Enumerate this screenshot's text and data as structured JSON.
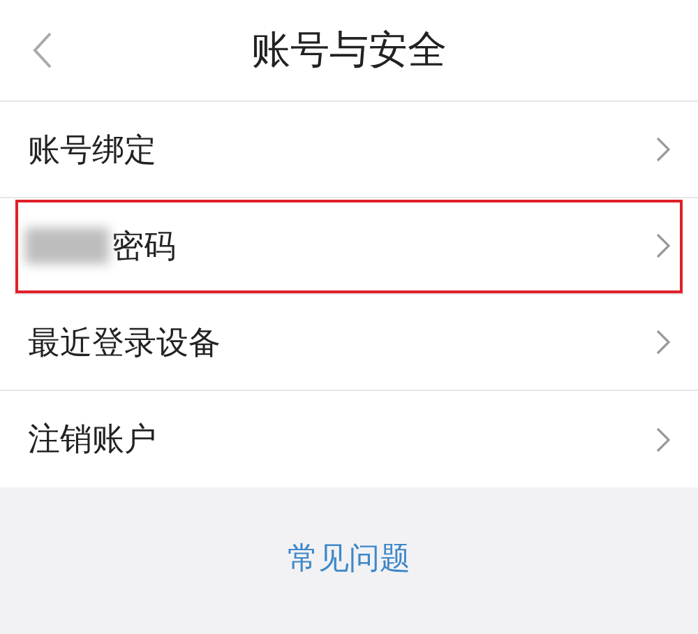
{
  "header": {
    "title": "账号与安全"
  },
  "items": [
    {
      "label": "账号绑定",
      "redacted": false,
      "highlighted": false
    },
    {
      "label": "密码",
      "redacted": true,
      "highlighted": true
    },
    {
      "label": "最近登录设备",
      "redacted": false,
      "highlighted": false
    },
    {
      "label": "注销账户",
      "redacted": false,
      "highlighted": false
    }
  ],
  "footer": {
    "link": "常见问题"
  }
}
